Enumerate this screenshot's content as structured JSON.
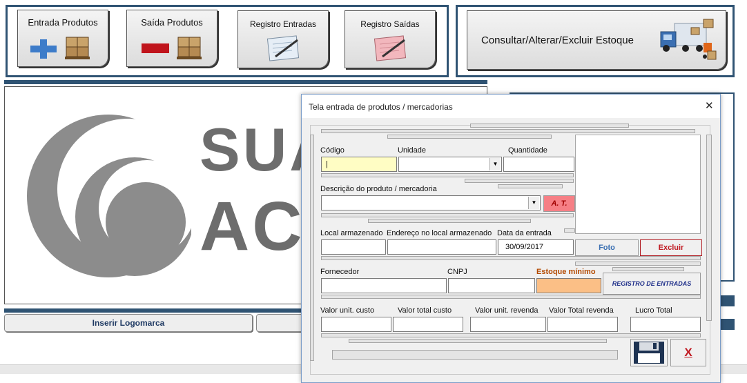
{
  "toolbar": {
    "entrada_produtos": "Entrada Produtos",
    "saida_produtos": "Saída Produtos",
    "registro_entradas": "Registro Entradas",
    "registro_saidas": "Registro  Saídas",
    "consultar_estoque": "Consultar/Alterar/Excluir Estoque"
  },
  "logo": {
    "line1": "SUA",
    "line2": "AC"
  },
  "bottom": {
    "inserir_logomarca": "Inserir Logomarca"
  },
  "dialog": {
    "title": "Tela entrada de produtos / mercadorias",
    "close_glyph": "✕",
    "labels": {
      "codigo": "Código",
      "unidade": "Unidade",
      "quantidade": "Quantidade",
      "descricao": "Descrição do produto / mercadoria",
      "local": "Local armazenado",
      "endereco": "Endereço no local armazenado",
      "data": "Data da entrada",
      "fornecedor": "Fornecedor",
      "cnpj": "CNPJ",
      "estoque_minimo": "Estoque mínimo",
      "valor_unit_custo": "Valor unit. custo",
      "valor_total_custo": "Valor total custo",
      "valor_unit_revenda": "Valor unit. revenda",
      "valor_total_revenda": "Valor Total revenda",
      "lucro_total": "Lucro Total"
    },
    "values": {
      "codigo": "|",
      "data": "30/09/2017"
    },
    "buttons": {
      "at": "A. T.",
      "foto": "Foto",
      "excluir": "Excluir",
      "registro_entradas": "REGISTRO DE ENTRADAS",
      "close_x": "X"
    }
  },
  "colors": {
    "frame_blue": "#2f5373",
    "codigo_bg": "#fffdc4",
    "estoque_bg": "#fbbf86",
    "at_bg": "#f67f85"
  }
}
